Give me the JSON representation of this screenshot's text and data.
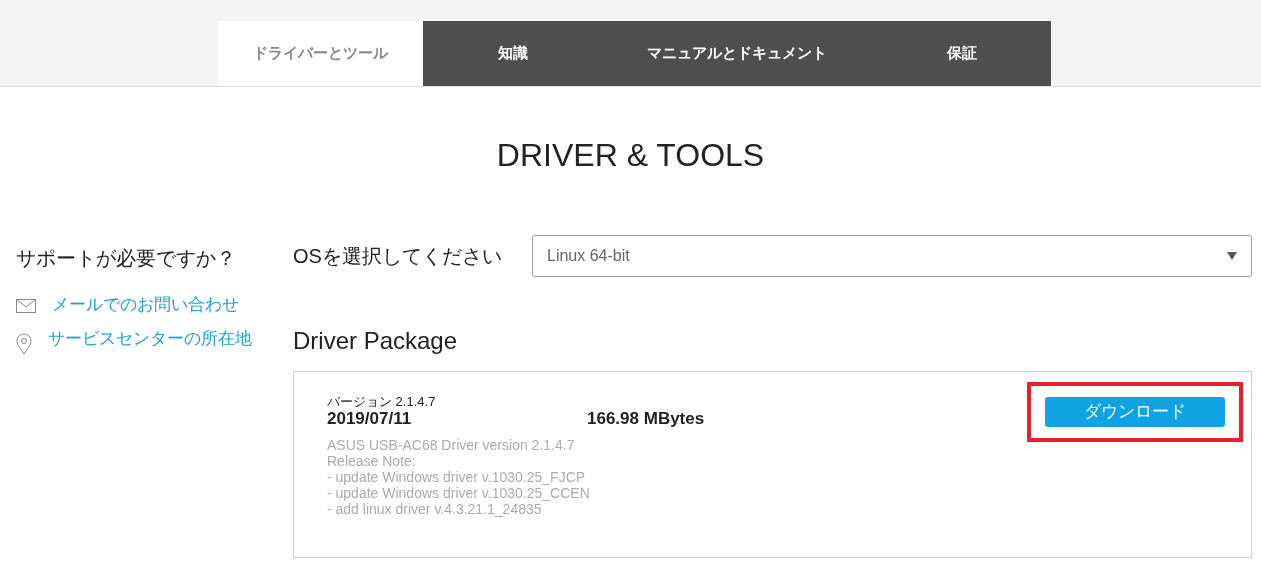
{
  "tabs": [
    {
      "label": "ドライバーとツール",
      "selected": true
    },
    {
      "label": "知識",
      "selected": false
    },
    {
      "label": "マニュアルとドキュメント",
      "selected": false
    },
    {
      "label": "保証",
      "selected": false
    }
  ],
  "title": "DRIVER & TOOLS",
  "sidebar": {
    "heading": "サポートが必要ですか？",
    "links": [
      {
        "kind": "mail",
        "label": "メールでのお問い合わせ"
      },
      {
        "kind": "location",
        "label": "サービスセンターの所在地"
      }
    ]
  },
  "os_select": {
    "label": "OSを選択してください",
    "value": "Linux 64-bit"
  },
  "section_title": "Driver Package",
  "package": {
    "version": "バージョン 2.1.4.7",
    "date": "2019/07/11",
    "size": "166.98 MBytes",
    "notes": [
      "ASUS USB-AC68 Driver version 2.1.4.7",
      "Release Note:",
      "- update Windows driver v.1030.25_FJCP",
      "- update Windows driver v.1030.25_CCEN",
      "- add linux driver v.4.3.21.1_24835"
    ],
    "download": {
      "label": "ダウンロード",
      "highlighted": true
    }
  }
}
